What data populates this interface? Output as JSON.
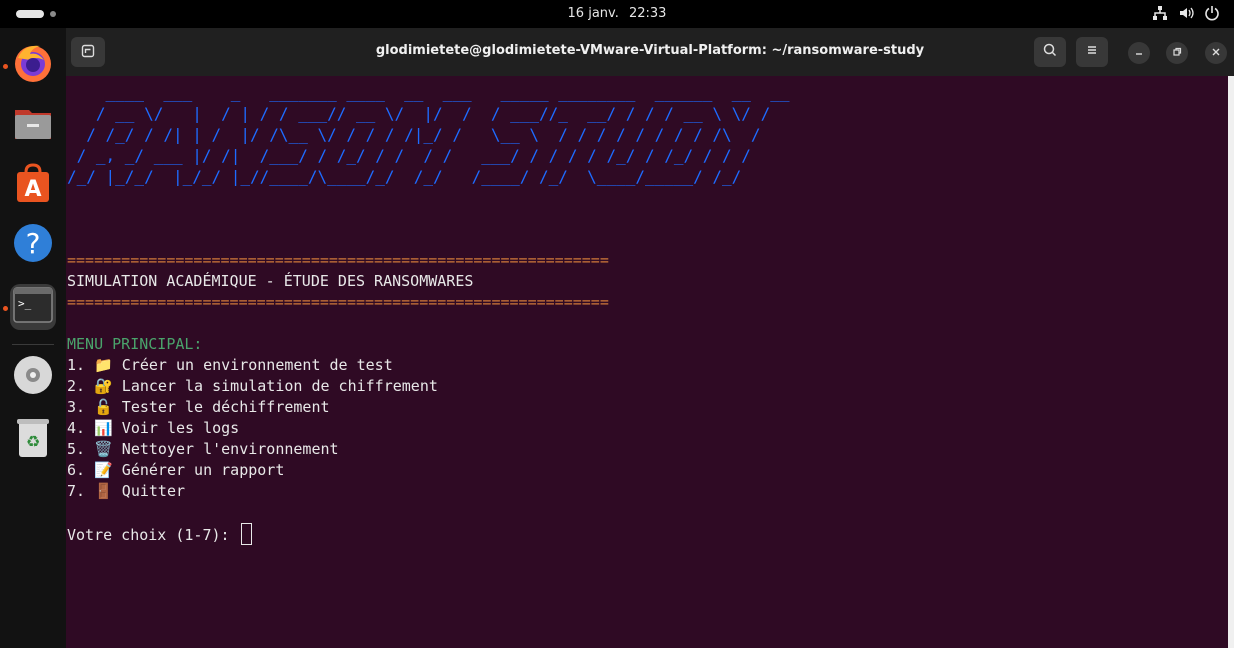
{
  "topbar": {
    "date": "16 janv.",
    "time": "22:33"
  },
  "dock": {
    "apps": [
      {
        "name": "Firefox",
        "icon": "firefox-icon",
        "running": true
      },
      {
        "name": "Files",
        "icon": "files-icon",
        "running": false
      },
      {
        "name": "App Center",
        "icon": "app-center-icon",
        "running": false
      },
      {
        "name": "Help",
        "icon": "help-icon",
        "running": false
      },
      {
        "name": "Terminal",
        "icon": "terminal-icon",
        "running": true
      },
      {
        "name": "Disc",
        "icon": "disc-icon",
        "running": false
      },
      {
        "name": "Trash",
        "icon": "trash-icon",
        "running": false
      }
    ]
  },
  "window": {
    "title": "glodimietete@glodimietete-VMware-Virtual-Platform: ~/ransomware-study"
  },
  "terminal": {
    "ascii_banner": "    ____  ___    _   _______ ____  __  ___   _____ ________  ______  __  __\n   / __ \\/   |  / | / / ___// __ \\/  |/  /  / ___//_  __/ / / / __ \\ \\/ /\n  / /_/ / /| | /  |/ /\\__ \\/ / / / /|_/ /   \\__ \\  / / / / / / / / /\\  /\n / _, _/ ___ |/ /|  /___/ / /_/ / /  / /   ___/ / / / / /_/ / /_/ / / /\n/_/ |_/_/  |_/_/ |_//____/\\____/_/  /_/   /____/ /_/  \\____/_____/ /_/",
    "separator": "============================================================",
    "heading": "SIMULATION ACADÉMIQUE - ÉTUDE DES RANSOMWARES",
    "menu_title": "MENU PRINCIPAL:",
    "menu": [
      "1. 📁 Créer un environnement de test",
      "2. 🔐 Lancer la simulation de chiffrement",
      "3. 🔓 Tester le déchiffrement",
      "4. 📊 Voir les logs",
      "5. 🗑️ Nettoyer l'environnement",
      "6. 📝 Générer un rapport",
      "7. 🚪 Quitter"
    ],
    "prompt": "Votre choix (1-7): "
  },
  "colors": {
    "terminal_bg": "#2f0a24",
    "ascii": "#1e6bff",
    "separator": "#d07a3a",
    "menu_title": "#4aa36b",
    "accent": "#e95420"
  }
}
